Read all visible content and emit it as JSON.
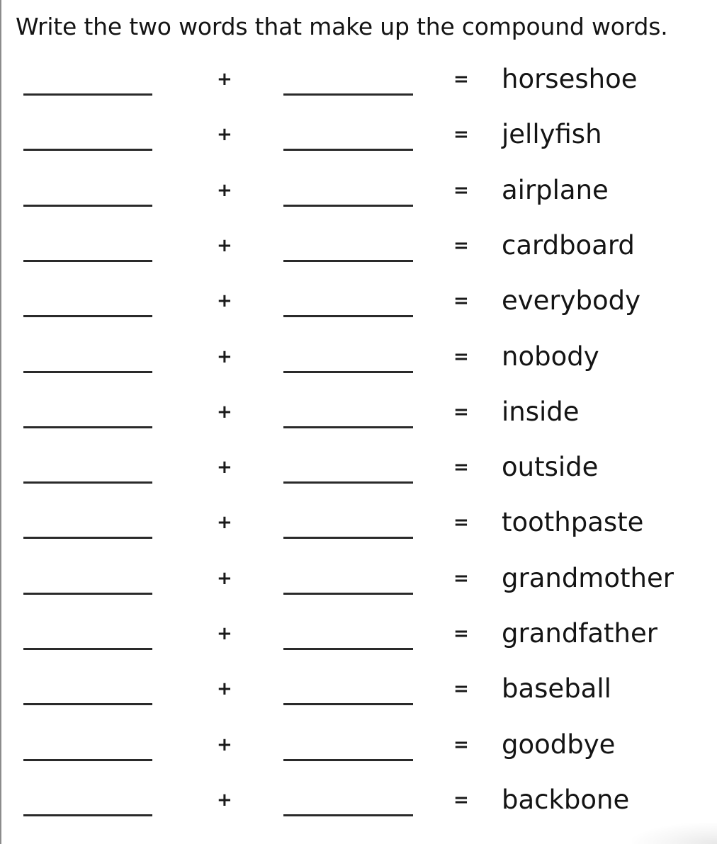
{
  "worksheet": {
    "instruction": "Write the two words that make up the compound words.",
    "plus_symbol": "+",
    "equals_symbol": "=",
    "items": [
      {
        "compound": "horseshoe",
        "part1": "",
        "part2": ""
      },
      {
        "compound": "jellyfish",
        "part1": "",
        "part2": ""
      },
      {
        "compound": "airplane",
        "part1": "",
        "part2": ""
      },
      {
        "compound": "cardboard",
        "part1": "",
        "part2": ""
      },
      {
        "compound": "everybody",
        "part1": "",
        "part2": ""
      },
      {
        "compound": "nobody",
        "part1": "",
        "part2": ""
      },
      {
        "compound": "inside",
        "part1": "",
        "part2": ""
      },
      {
        "compound": "outside",
        "part1": "",
        "part2": ""
      },
      {
        "compound": "toothpaste",
        "part1": "",
        "part2": ""
      },
      {
        "compound": "grandmother",
        "part1": "",
        "part2": ""
      },
      {
        "compound": "grandfather",
        "part1": "",
        "part2": ""
      },
      {
        "compound": "baseball",
        "part1": "",
        "part2": ""
      },
      {
        "compound": "goodbye",
        "part1": "",
        "part2": ""
      },
      {
        "compound": "backbone",
        "part1": "",
        "part2": ""
      }
    ]
  },
  "colors": {
    "text": "#141414",
    "blank_line": "#2a2a2a",
    "page_border": "#8c8c8c",
    "background": "#ffffff"
  }
}
